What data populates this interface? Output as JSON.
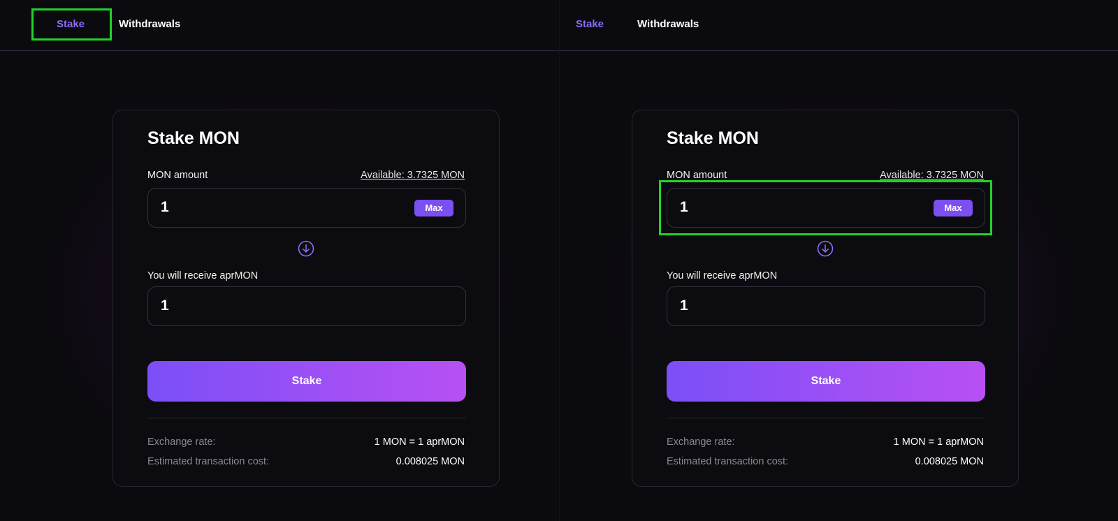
{
  "nav": {
    "stake": "Stake",
    "withdrawals": "Withdrawals"
  },
  "card": {
    "title": "Stake MON",
    "amount_label": "MON amount",
    "available": "Available: 3.7325 MON",
    "amount_value": "1",
    "max_label": "Max",
    "receive_label": "You will receive aprMON",
    "receive_value": "1",
    "stake_button": "Stake",
    "exchange_rate_label": "Exchange rate:",
    "exchange_rate_value": "1 MON = 1 aprMON",
    "tx_cost_label": "Estimated transaction cost:",
    "tx_cost_value": "0.008025 MON"
  },
  "colors": {
    "accent": "#8b6cf6",
    "max_button": "#7b4ff0",
    "stake_gradient_start": "#7b4ff7",
    "stake_gradient_end": "#b850f3",
    "annotation_highlight": "#22d32a"
  },
  "icons": {
    "arrow": "arrow-down-circle-icon"
  }
}
